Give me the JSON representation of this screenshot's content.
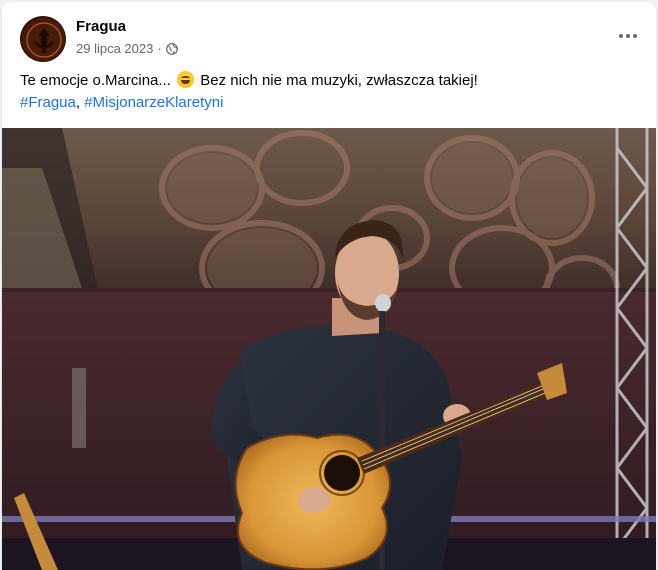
{
  "post": {
    "author": "Fragua",
    "date": "29 lipca 2023",
    "separator": "·",
    "privacy_icon": "globe-icon",
    "more_icon": "more-horizontal-icon",
    "text_before_emoji": "Te emocje o.Marcina...",
    "emoji": "grinning-face-emoji",
    "text_after_emoji": "Bez nich nie ma muzyki, zwłaszcza takiej!",
    "hashtags": [
      "#Fragua",
      "#MisjonarzeKlaretyni"
    ],
    "hashtag_separator": ", "
  },
  "colors": {
    "link": "#1b74e4",
    "secondary_text": "#65676b",
    "primary_text": "#050505"
  }
}
